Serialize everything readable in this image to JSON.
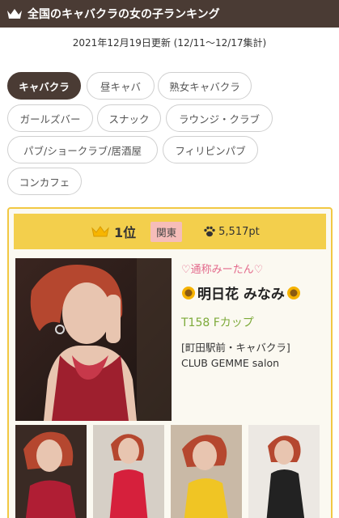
{
  "header": {
    "title": "全国のキャバクラの女の子ランキング",
    "icon": "crown-icon"
  },
  "date_line": "2021年12月19日更新 (12/11〜12/17集計)",
  "categories": [
    {
      "label": "キャバクラ",
      "active": true
    },
    {
      "label": "昼キャバ",
      "active": false
    },
    {
      "label": "熟女キャバクラ",
      "active": false
    },
    {
      "label": "ガールズバー",
      "active": false
    },
    {
      "label": "スナック",
      "active": false
    },
    {
      "label": "ラウンジ・クラブ",
      "active": false
    },
    {
      "label": "パブ/ショークラブ/居酒屋",
      "active": false
    },
    {
      "label": "フィリピンパブ",
      "active": false
    },
    {
      "label": "コンカフェ",
      "active": false
    }
  ],
  "ranking_card": {
    "rank": "1位",
    "region": "関東",
    "points": "5,517pt",
    "nickname": "♡通称みーたん♡",
    "name": "明日花 みなみ",
    "spec": "T158 Fカップ",
    "location": "[町田駅前・キャバクラ]",
    "shop": "CLUB GEMME salon"
  },
  "colors": {
    "header_bg": "#4a3b34",
    "rank_bar": "#f3cf4c",
    "card_border": "#f2c843",
    "region_badge": "#f6bdb9",
    "nickname": "#e36a8c",
    "spec": "#7daa3a"
  }
}
